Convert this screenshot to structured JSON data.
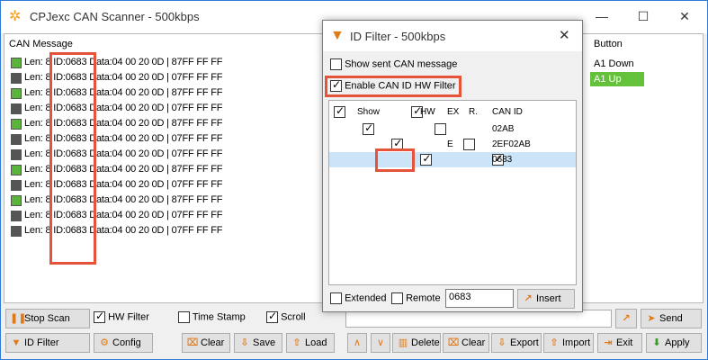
{
  "window": {
    "title": "CPJexc CAN Scanner - 500kbps",
    "minimize": "—",
    "maximize": "☐",
    "close": "✕"
  },
  "messages": {
    "header": "CAN Message",
    "rows": [
      {
        "text": "Len: 8 ID:0683 Data:04 00 20 0D | 87FF FF FF",
        "color": "#5ab33a"
      },
      {
        "text": "Len: 8 ID:0683 Data:04 00 20 0D | 07FF FF FF",
        "color": "#555555"
      },
      {
        "text": "Len: 8 ID:0683 Data:04 00 20 0D | 87FF FF FF",
        "color": "#5ab33a"
      },
      {
        "text": "Len: 8 ID:0683 Data:04 00 20 0D | 07FF FF FF",
        "color": "#555555"
      },
      {
        "text": "Len: 8 ID:0683 Data:04 00 20 0D | 87FF FF FF",
        "color": "#5ab33a"
      },
      {
        "text": "Len: 8 ID:0683 Data:04 00 20 0D | 07FF FF FF",
        "color": "#555555"
      },
      {
        "text": "Len: 8 ID:0683 Data:04 00 20 0D | 07FF FF FF",
        "color": "#555555"
      },
      {
        "text": "Len: 8 ID:0683 Data:04 00 20 0D | 87FF FF FF",
        "color": "#5ab33a"
      },
      {
        "text": "Len: 8 ID:0683 Data:04 00 20 0D | 07FF FF FF",
        "color": "#555555"
      },
      {
        "text": "Len: 8 ID:0683 Data:04 00 20 0D | 87FF FF FF",
        "color": "#5ab33a"
      },
      {
        "text": "Len: 8 ID:0683 Data:04 00 20 0D | 07FF FF FF",
        "color": "#555555"
      },
      {
        "text": "Len: 8 ID:0683 Data:04 00 20 0D | 07FF FF FF",
        "color": "#555555"
      }
    ]
  },
  "buttons_panel": {
    "header": "Button",
    "items": [
      "A1 Down",
      "A1 Up"
    ]
  },
  "toolbar": {
    "stop_scan": "Stop Scan",
    "hw_filter": "HW Filter",
    "time_stamp": "Time Stamp",
    "scroll": "Scroll",
    "id_filter": "ID Filter",
    "config": "Config",
    "clear": "Clear",
    "save": "Save",
    "load": "Load",
    "delete": "Delete",
    "clear2": "Clear",
    "export": "Export",
    "import": "Import",
    "exit": "Exit",
    "apply": "Apply",
    "send": "Send"
  },
  "dialog": {
    "title": "ID Filter - 500kbps",
    "show_sent": "Show sent CAN message",
    "enable_hw": "Enable CAN ID HW Filter",
    "columns": [
      "Show",
      "HW",
      "EX",
      "R.",
      "CAN ID"
    ],
    "rows": [
      {
        "show": true,
        "hw": false,
        "ex": "",
        "r": "",
        "id": "02AB"
      },
      {
        "show": true,
        "hw": false,
        "ex": "E",
        "r": "",
        "id": "2EF02AB"
      },
      {
        "show": true,
        "hw": true,
        "ex": "",
        "r": "",
        "id": "0683"
      }
    ],
    "extended": "Extended",
    "remote": "Remote",
    "id_value": "0683",
    "insert": "Insert"
  },
  "colors": {
    "accent_green": "#64c23a",
    "highlight_red": "#e5533d",
    "selection_blue": "#cce4f7"
  }
}
